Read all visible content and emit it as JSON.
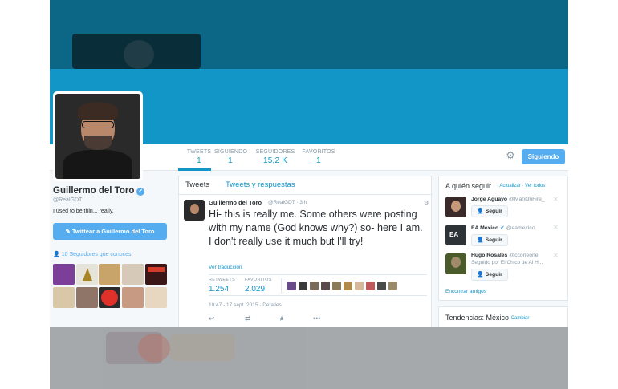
{
  "colors": {
    "header_dark": "#0b6785",
    "header_blue": "#1196c7",
    "accent": "#55acee",
    "muted": "#8899a6",
    "text": "#292f33"
  },
  "nav": {
    "stats": [
      {
        "label": "TWEETS",
        "value": "1"
      },
      {
        "label": "SIGUIENDO",
        "value": "1"
      },
      {
        "label": "SEGUIDORES",
        "value": "15,2 K"
      },
      {
        "label": "FAVORITOS",
        "value": "1"
      }
    ],
    "gear_icon": "gear-icon",
    "follow_button": "Siguiendo"
  },
  "profile": {
    "name": "Guillermo del Toro",
    "handle": "@RealGDT",
    "bio": "I used to be thin... really.",
    "tweet_to_button": "Twittear a Guillermo del Toro",
    "followers_you_know": "10 Seguidores que conoces",
    "verified_icon": "verified-badge-icon"
  },
  "timeline": {
    "tabs": [
      "Tweets",
      "Tweets y respuestas"
    ],
    "tweet": {
      "author": "Guillermo del Toro",
      "handle": "@RealGDT",
      "age": "3 h",
      "text": "Hi-  this is really me.  Some others were posting with my name (God knows why?) so- here I am.  I don't really use it much but I'll try!",
      "translate_link": "Ver traducción",
      "retweets_label": "RETWEETS",
      "retweets": "1.254",
      "favorites_label": "FAVORITOS",
      "favorites": "2.029",
      "timestamp": "10:47 - 17 sept. 2015",
      "details_link": "Detalles",
      "actions": [
        "reply-icon",
        "retweet-icon",
        "star-icon",
        "more-icon"
      ]
    }
  },
  "who_to_follow": {
    "title": "A quién seguir",
    "refresh_link": "Actualizar",
    "view_all_link": "Ver todos",
    "follow_label": "Seguir",
    "suggestions": [
      {
        "name": "Jorge Aguayo",
        "handle": "@ManOnFire_",
        "sub": ""
      },
      {
        "name": "EA Mexico",
        "handle": "@eamexico",
        "sub": ""
      },
      {
        "name": "Hugo Rosales",
        "handle": "@ccorleone",
        "sub": "Seguido por El Chico de Al H..."
      }
    ],
    "find_friends": "Encontrar amigos"
  },
  "trends": {
    "title": "Tendencias: México",
    "change_link": "Cambiar"
  }
}
